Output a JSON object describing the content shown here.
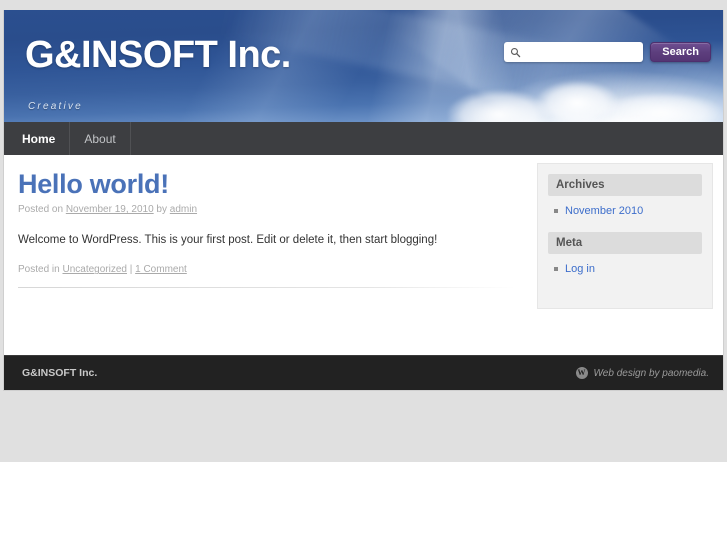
{
  "site": {
    "title": "G&INSOFT Inc.",
    "description": "Creative"
  },
  "search": {
    "value": "",
    "placeholder": "",
    "button_label": "Search",
    "icon": "search-icon"
  },
  "nav": {
    "items": [
      {
        "label": "Home",
        "active": true
      },
      {
        "label": "About",
        "active": false
      }
    ]
  },
  "post": {
    "title": "Hello world!",
    "meta_posted_on_prefix": "Posted on ",
    "date": "November 19, 2010",
    "meta_by": " by ",
    "author": "admin",
    "body": "Welcome to WordPress. This is your first post. Edit or delete it, then start blogging!",
    "footer_posted_in_prefix": "Posted in ",
    "category": "Uncategorized",
    "footer_separator": " | ",
    "comments": "1 Comment"
  },
  "sidebar": {
    "widgets": [
      {
        "title": "Archives",
        "items": [
          {
            "label": "November 2010"
          }
        ]
      },
      {
        "title": "Meta",
        "items": [
          {
            "label": "Log in"
          }
        ]
      }
    ]
  },
  "footer": {
    "site_name": "G&INSOFT Inc.",
    "badge_letter": "W",
    "credit": "Web design by paomedia."
  },
  "colors": {
    "accent_title": "#4a72b8",
    "link": "#3d6ecb",
    "search_button": "#5d3f7e",
    "header_sky": "#2a4d8c",
    "footer_bg": "#222222",
    "page_bg": "#e0e0e0"
  }
}
